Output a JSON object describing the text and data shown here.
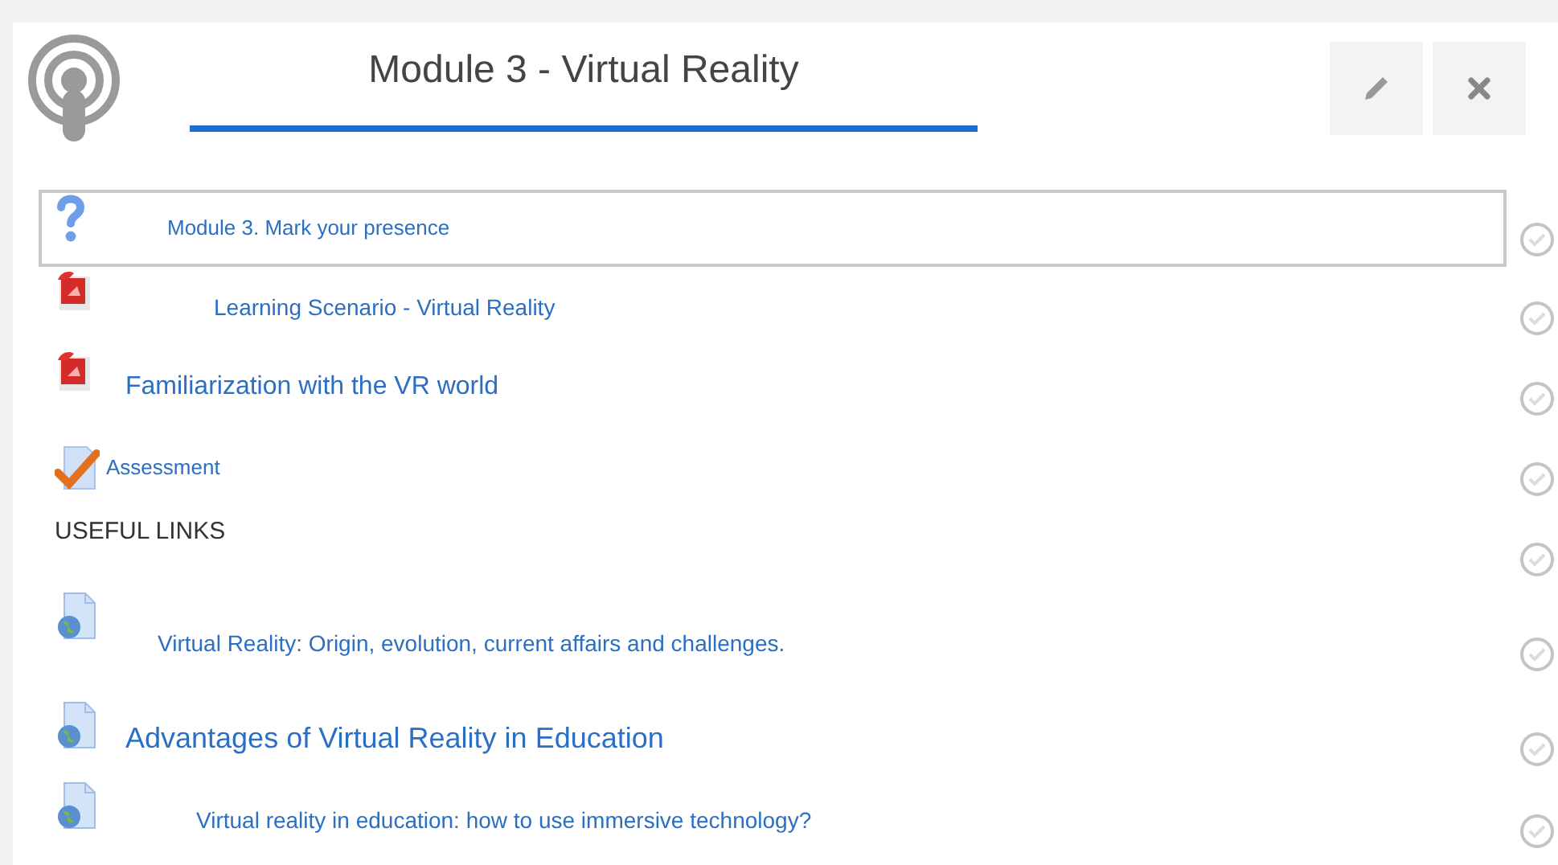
{
  "header": {
    "title": "Module 3 - Virtual Reality"
  },
  "items": [
    {
      "kind": "quiz",
      "label": "Module 3. Mark your presence",
      "selected": true,
      "complete": false
    },
    {
      "kind": "pdf",
      "label": "Learning Scenario - Virtual Reality",
      "selected": false,
      "complete": false
    },
    {
      "kind": "pdf",
      "label": "Familiarization with the VR world",
      "selected": false,
      "complete": false
    },
    {
      "kind": "assignment",
      "label": "Assessment",
      "selected": false,
      "complete": false
    },
    {
      "kind": "heading",
      "label": "USEFUL LINKS",
      "selected": false,
      "complete": false
    },
    {
      "kind": "url",
      "label": "Virtual Reality: Origin, evolution, current affairs and challenges.",
      "selected": false,
      "complete": false
    },
    {
      "kind": "url",
      "label": "Advantages of Virtual Reality in Education",
      "selected": false,
      "complete": false
    },
    {
      "kind": "url",
      "label": "Virtual reality in education: how to use immersive technology?",
      "selected": false,
      "complete": false
    }
  ]
}
